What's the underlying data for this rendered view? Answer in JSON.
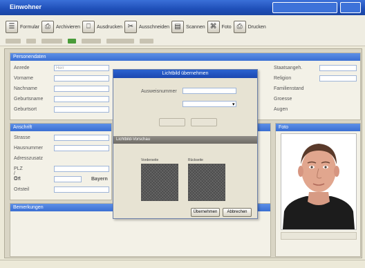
{
  "window": {
    "title": "Einwohner",
    "sys_box": "— □ ×"
  },
  "toolbar": {
    "items": [
      {
        "icon": "form-icon",
        "label": "Formular"
      },
      {
        "icon": "folder-icon",
        "label": "Archivieren"
      },
      {
        "icon": "printer-icon",
        "label": "Ausdrucken"
      },
      {
        "icon": "scissors-icon",
        "label": "Ausschneiden"
      },
      {
        "icon": "scanner-icon",
        "label": "Scannen"
      },
      {
        "icon": "camera-icon",
        "label": "Foto"
      },
      {
        "icon": "copy-icon",
        "label": "Drucken"
      }
    ],
    "glyphs": [
      "☰",
      "⎙",
      "⎕",
      "✂",
      "▤",
      "⌘",
      "⎙"
    ]
  },
  "personal": {
    "header": "Personendaten",
    "fields": [
      {
        "label": "Anrede",
        "value": "Herr"
      },
      {
        "label": "Vorname",
        "value": ""
      },
      {
        "label": "Nachname",
        "value": ""
      },
      {
        "label": "Geburtsname",
        "value": ""
      },
      {
        "label": "Geburtsort",
        "value": ""
      }
    ],
    "right_fields": [
      {
        "label": "Staatsangeh.",
        "value": ""
      },
      {
        "label": "Religion",
        "value": ""
      },
      {
        "label": "Familienstand",
        "value": ""
      },
      {
        "label": "Groesse",
        "value": ""
      },
      {
        "label": "Augen",
        "value": ""
      }
    ]
  },
  "address": {
    "header": "Anschrift",
    "fields": [
      {
        "label": "Strasse",
        "value": ""
      },
      {
        "label": "Hausnummer",
        "value": ""
      },
      {
        "label": "Adresszusatz",
        "value": ""
      },
      {
        "label": "PLZ / Ort",
        "value": ""
      },
      {
        "label": "Ort",
        "value": ""
      },
      {
        "label": "Ortsteil",
        "value": ""
      }
    ],
    "state_label": "Bayern"
  },
  "notes": {
    "header": "Bemerkungen"
  },
  "photo": {
    "header": "Foto"
  },
  "dialog": {
    "title": "Lichtbild übernehmen",
    "field_label": "Ausweisnummer",
    "select_value": "",
    "btn1": "",
    "btn2": "",
    "section": "Lichtbild-Vorschau",
    "thumb1_label": "Vorderseite",
    "thumb2_label": "Rückseite",
    "ok": "Übernehmen",
    "cancel": "Abbrechen"
  },
  "status": {
    "left": "",
    "right": ""
  }
}
